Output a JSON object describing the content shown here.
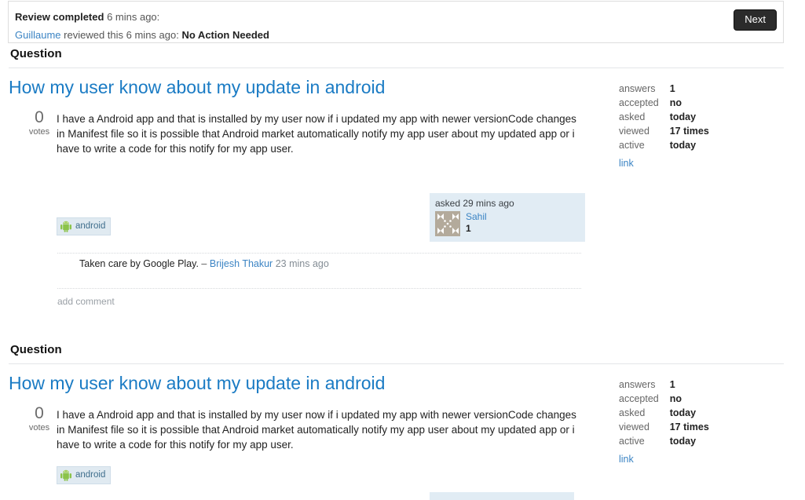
{
  "review_banner": {
    "status_label": "Review completed",
    "status_time": "6 mins ago:",
    "reviewer": "Guillaume",
    "reviewed_text": "reviewed this 6 mins ago:",
    "outcome": "No Action Needed",
    "next_label": "Next"
  },
  "questions": [
    {
      "section_label": "Question",
      "title": "How my user know about my update in android",
      "votes": "0",
      "votes_label": "votes",
      "body": "I have a Android app and that is installed by my user now if i updated my app with newer versionCode changes in Manifest file so it is possible that Android market automatically notify my app user about my updated app or i have to write a code for this notify for my app user.",
      "tag": "android",
      "stats": [
        {
          "key": "answers",
          "value": "1"
        },
        {
          "key": "accepted",
          "value": "no"
        },
        {
          "key": "asked",
          "value": "today"
        },
        {
          "key": "viewed",
          "value": "17 times"
        },
        {
          "key": "active",
          "value": "today"
        }
      ],
      "link_label": "link",
      "user_card": {
        "when": "asked 29 mins ago",
        "name": "Sahil",
        "reputation": "1"
      },
      "comment": {
        "text": "Taken care by Google Play.",
        "dash": "–",
        "author": "Brijesh Thakur",
        "time": "23 mins ago"
      },
      "add_comment_label": "add comment"
    },
    {
      "section_label": "Question",
      "title": "How my user know about my update in android",
      "votes": "0",
      "votes_label": "votes",
      "body": "I have a Android app and that is installed by my user now if i updated my app with newer versionCode changes in Manifest file so it is possible that Android market automatically notify my app user about my updated app or i have to write a code for this notify for my app user.",
      "tag": "android",
      "stats": [
        {
          "key": "answers",
          "value": "1"
        },
        {
          "key": "accepted",
          "value": "no"
        },
        {
          "key": "asked",
          "value": "today"
        },
        {
          "key": "viewed",
          "value": "17 times"
        },
        {
          "key": "active",
          "value": "today"
        }
      ],
      "link_label": "link"
    }
  ],
  "colors": {
    "link": "#3b84c4",
    "title_link": "#1a7bc4",
    "tag_bg": "#e0eaf1",
    "user_card_bg": "#e1ecf4",
    "next_button_bg": "#2b2b2b"
  }
}
